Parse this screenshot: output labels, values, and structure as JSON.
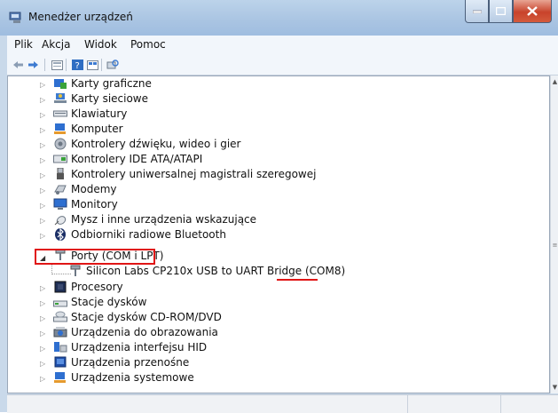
{
  "window": {
    "title": "Menedżer urządzeń"
  },
  "menu": [
    "Plik",
    "Akcja",
    "Widok",
    "Pomoc"
  ],
  "toolbar_icons": [
    "back-arrow-icon",
    "forward-arrow-icon",
    "properties-icon",
    "help-icon",
    "device-view-icon",
    "scan-hardware-icon"
  ],
  "tree": [
    {
      "label": "Karty graficzne",
      "icon": "display-adapter-icon",
      "expanded": false,
      "level": 0
    },
    {
      "label": "Karty sieciowe",
      "icon": "network-adapter-icon",
      "expanded": false,
      "level": 0
    },
    {
      "label": "Klawiatury",
      "icon": "keyboard-icon",
      "expanded": false,
      "level": 0
    },
    {
      "label": "Komputer",
      "icon": "computer-icon",
      "expanded": false,
      "level": 0
    },
    {
      "label": "Kontrolery dźwięku, wideo i gier",
      "icon": "sound-icon",
      "expanded": false,
      "level": 0
    },
    {
      "label": "Kontrolery IDE ATA/ATAPI",
      "icon": "ide-controller-icon",
      "expanded": false,
      "level": 0
    },
    {
      "label": "Kontrolery uniwersalnej magistrali szeregowej",
      "icon": "usb-icon",
      "expanded": false,
      "level": 0
    },
    {
      "label": "Modemy",
      "icon": "modem-icon",
      "expanded": false,
      "level": 0
    },
    {
      "label": "Monitory",
      "icon": "monitor-icon",
      "expanded": false,
      "level": 0
    },
    {
      "label": "Mysz i inne urządzenia wskazujące",
      "icon": "mouse-icon",
      "expanded": false,
      "level": 0
    },
    {
      "label": "Odbiorniki radiowe Bluetooth",
      "icon": "bluetooth-icon",
      "expanded": false,
      "level": 0
    },
    {
      "label": "Porty (COM i LPT)",
      "icon": "port-icon",
      "expanded": true,
      "level": 0
    },
    {
      "label": "Silicon Labs CP210x USB to UART Bridge (COM8)",
      "icon": "port-icon",
      "expanded": false,
      "level": 1
    },
    {
      "label": "Procesory",
      "icon": "processor-icon",
      "expanded": false,
      "level": 0
    },
    {
      "label": "Stacje dysków",
      "icon": "disk-drive-icon",
      "expanded": false,
      "level": 0
    },
    {
      "label": "Stacje dysków CD-ROM/DVD",
      "icon": "cdrom-icon",
      "expanded": false,
      "level": 0
    },
    {
      "label": "Urządzenia do obrazowania",
      "icon": "imaging-icon",
      "expanded": false,
      "level": 0
    },
    {
      "label": "Urządzenia interfejsu HID",
      "icon": "hid-icon",
      "expanded": false,
      "level": 0
    },
    {
      "label": "Urządzenia przenośne",
      "icon": "portable-device-icon",
      "expanded": false,
      "level": 0
    },
    {
      "label": "Urządzenia systemowe",
      "icon": "system-device-icon",
      "expanded": false,
      "level": 0
    }
  ],
  "colors": {
    "highlight": "#e01515",
    "titlebar": "#a9c4e2",
    "close": "#c8432b"
  }
}
